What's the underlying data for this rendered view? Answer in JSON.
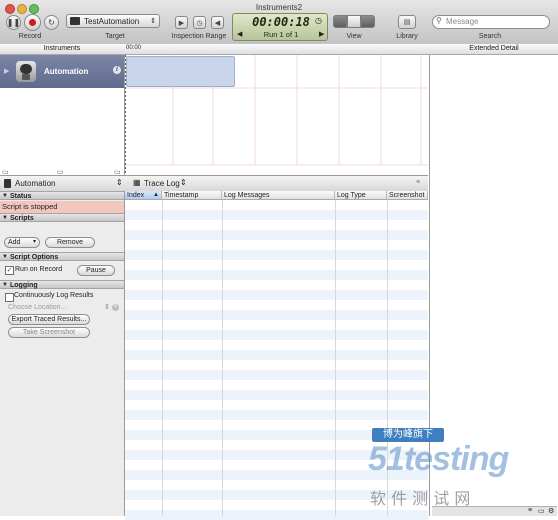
{
  "window": {
    "title": "Instruments2"
  },
  "toolbar": {
    "record_label": "Record",
    "target_label": "Target",
    "target_value": "TestAutomation",
    "inspection_label": "Inspection Range",
    "timer": "00:00:18",
    "run_text": "Run 1 of 1",
    "view_label": "View",
    "library_label": "Library",
    "search_placeholder": "Message",
    "search_label": "Search"
  },
  "header": {
    "instruments": "Instruments",
    "ruler_start": "00:00",
    "extended_detail": "Extended Detail"
  },
  "instrument": {
    "name": "Automation"
  },
  "middle_bar": {
    "selector": "Automation",
    "view": "Trace Log"
  },
  "sidebar": {
    "status_header": "Status",
    "status_text": "Script is stopped",
    "scripts_header": "Scripts",
    "add_label": "Add",
    "remove_label": "Remove",
    "options_header": "Script Options",
    "run_on_record": "Run on Record",
    "pause_label": "Pause",
    "logging_header": "Logging",
    "continuously_log": "Continuously Log Results",
    "choose_location": "Choose Location...",
    "export_label": "Export Traced Results...",
    "screenshot_label": "Take Screenshot"
  },
  "table": {
    "columns": [
      "Index",
      "Timestamp",
      "Log Messages",
      "Log Type",
      "Screenshot"
    ]
  },
  "watermark": {
    "badge": "博为峰旗下",
    "brand": "51testing",
    "sub": "软 件 测 试 网"
  }
}
